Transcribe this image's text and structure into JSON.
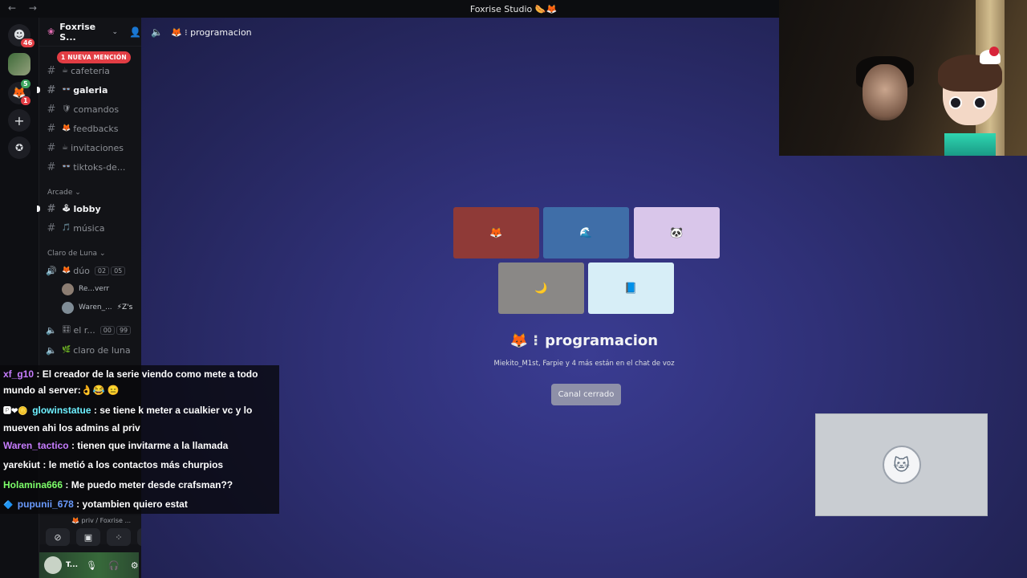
{
  "window": {
    "title": "Foxrise Studio 🌭🦊",
    "nav": "← →"
  },
  "rail": {
    "dm_badge": "46",
    "server2_badge": "1",
    "server2_top_badge": "5"
  },
  "sidebar": {
    "guild_name": "Foxrise S...",
    "mention_banner": "1 NUEVA MENCIÓN",
    "channels": [
      {
        "emoji": "☕",
        "name": "cafeteria",
        "unread": false
      },
      {
        "emoji": "👓",
        "name": "galeria",
        "unread": true
      },
      {
        "emoji": "🛡",
        "name": "comandos",
        "unread": false
      },
      {
        "emoji": "🦊",
        "name": "feedbacks",
        "unread": false
      },
      {
        "emoji": "☕",
        "name": "invitaciones",
        "unread": false
      },
      {
        "emoji": "👓",
        "name": "tiktoks-de...",
        "unread": false
      }
    ],
    "category_arcade": "Arcade",
    "arcade_channels": [
      {
        "emoji": "🕹",
        "name": "lobby",
        "unread": true
      },
      {
        "emoji": "🎵",
        "name": "música",
        "unread": false
      }
    ],
    "category_luna": "Claro de Luna",
    "voice_duo": {
      "name": "dúo",
      "count_a": "02",
      "count_b": "05"
    },
    "voice_users": [
      {
        "name": "Re...verr"
      },
      {
        "name": "Waren_...",
        "tag": "⚡Z's"
      }
    ],
    "voice_rl": {
      "name": "el r...",
      "count_a": "00",
      "count_b": "99"
    },
    "voice_luna": {
      "name": "claro de luna"
    },
    "voice_status": {
      "channel": "🦊 priv / Foxrise ..."
    },
    "user": {
      "name": "T..."
    }
  },
  "stage": {
    "header_channel": "🦊 ⁝ programacion",
    "channel_title": "programacion",
    "channel_emoji": "🦊",
    "subtitle": "Miekito_M1st, Farpie y 4 más están en el chat de voz",
    "closed_button": "Canal cerrado",
    "tiles": [
      {
        "color": "#8f3a37",
        "icon": "🦊"
      },
      {
        "color": "#3f6ea8",
        "icon": "🌊"
      },
      {
        "color": "#d9c6ea",
        "icon": "🐼"
      },
      {
        "color": "#8a8886",
        "icon": "🌙"
      },
      {
        "color": "#d7eef7",
        "icon": "📘"
      }
    ]
  },
  "chat": [
    {
      "user": "xf_g10",
      "color": "#c77dff",
      "icon": "",
      "text": ": El creador de la serie viendo como mete a todo mundo al server:👌😂 😑"
    },
    {
      "user": "glowinstatue",
      "color": "#6df0ff",
      "icon": "🅿❤🪙",
      "text": ": se tiene k meter a cualkier vc y lo mueven ahi los admins al priv"
    },
    {
      "user": "Waren_tactico",
      "color": "#c77dff",
      "icon": "",
      "text": ": tienen que invitarme a la llamada"
    },
    {
      "user": "yarekiut",
      "color": "#ffffff",
      "icon": "",
      "text": ": le metió a los contactos más churpios"
    },
    {
      "user": "Holamina666",
      "color": "#7dff6a",
      "icon": "",
      "text": ": Me puedo meter desde crafsman??"
    },
    {
      "user": "pupunii_678",
      "color": "#6a9bff",
      "icon": "🔷",
      "text": ": yotambien quiero estat"
    }
  ]
}
